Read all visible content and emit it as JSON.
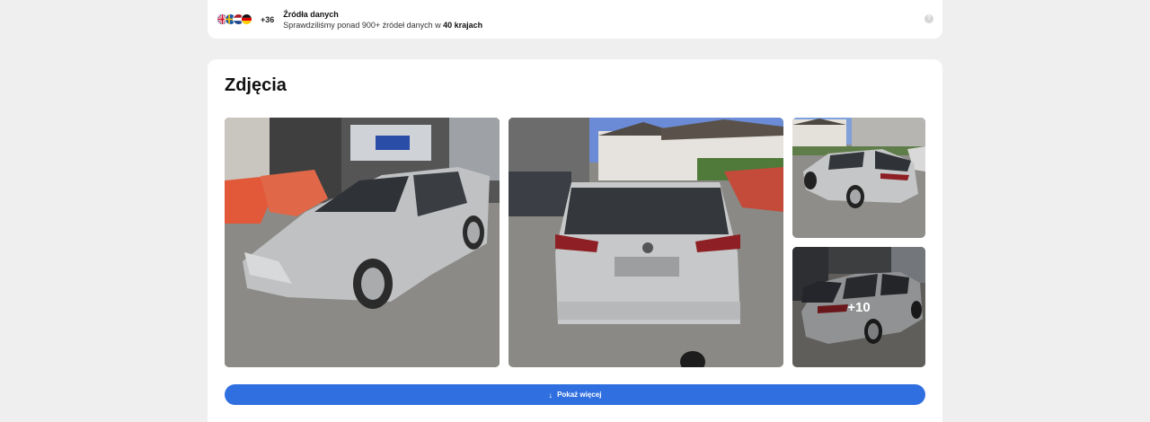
{
  "sources": {
    "flags": [
      "gb-flag-icon",
      "se-flag-icon",
      "nl-flag-icon",
      "de-flag-icon"
    ],
    "more_count": "+36",
    "title": "Źródła danych",
    "subtitle_prefix": "Sprawdziliśmy ponad 900+ źródeł danych w ",
    "subtitle_bold": "40 krajach",
    "help_icon": "?"
  },
  "photos": {
    "title": "Zdjęcia",
    "remaining_count": "+10",
    "show_more_label": "Pokaż więcej",
    "show_more_icon": "↓"
  },
  "colors": {
    "accent": "#2f6fe0",
    "background": "#efefef"
  }
}
